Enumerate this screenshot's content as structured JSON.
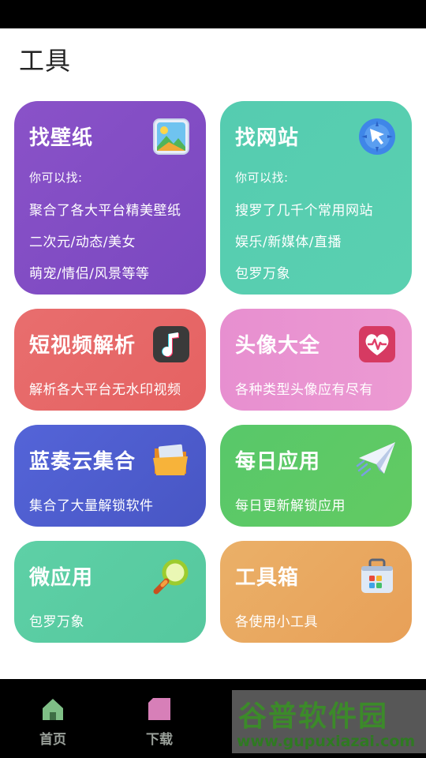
{
  "page": {
    "title": "工具"
  },
  "cards": [
    {
      "title": "找壁纸",
      "icon": "wallpaper-icon",
      "lines": [
        "你可以找:",
        "聚合了各大平台精美壁纸",
        "二次元/动态/美女",
        "萌宠/情侣/风景等等"
      ]
    },
    {
      "title": "找网站",
      "icon": "compass-cursor-icon",
      "lines": [
        "你可以找:",
        "搜罗了几千个常用网站",
        "娱乐/新媒体/直播",
        "包罗万象"
      ]
    },
    {
      "title": "短视频解析",
      "icon": "music-note-icon",
      "lines": [
        "解析各大平台无水印视频"
      ]
    },
    {
      "title": "头像大全",
      "icon": "heart-pulse-icon",
      "lines": [
        "各种类型头像应有尽有"
      ]
    },
    {
      "title": "蓝奏云集合",
      "icon": "folder-icon",
      "lines": [
        "集合了大量解锁软件"
      ]
    },
    {
      "title": "每日应用",
      "icon": "paper-plane-icon",
      "lines": [
        "每日更新解锁应用"
      ]
    },
    {
      "title": "微应用",
      "icon": "magnifier-icon",
      "lines": [
        "包罗万象"
      ]
    },
    {
      "title": "工具箱",
      "icon": "toolbox-icon",
      "lines": [
        "各使用小工具"
      ]
    }
  ],
  "tabbar": {
    "items": [
      {
        "label": "首页",
        "icon": "home-icon"
      },
      {
        "label": "下载",
        "icon": "download-icon"
      }
    ]
  },
  "watermark": {
    "title": "谷普软件园",
    "url": "www.gupuxiazai.com"
  }
}
